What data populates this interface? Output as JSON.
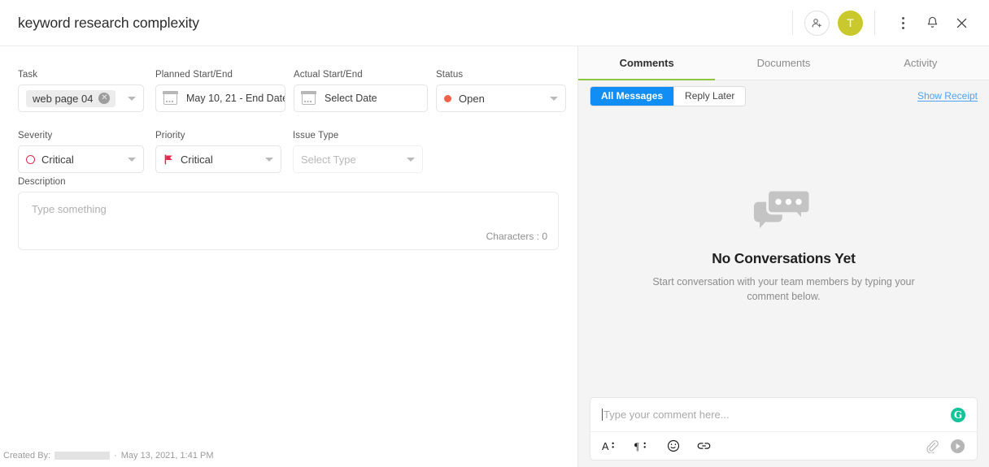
{
  "header": {
    "title": "keyword research complexity",
    "invite_icon": "add-person-icon",
    "avatar_initial": "T",
    "avatar_color": "#c9c92d",
    "more_icon": "vertical-dots-icon",
    "notifications_icon": "bell-icon",
    "close_icon": "close-icon"
  },
  "form": {
    "task": {
      "label": "Task",
      "chip_value": "web page 04",
      "remove_icon": "remove-chip-icon"
    },
    "planned": {
      "label": "Planned Start/End",
      "value": "May 10, 21 - End Date",
      "icon": "calendar-icon"
    },
    "actual": {
      "label": "Actual Start/End",
      "value": "Select Date",
      "icon": "calendar-icon",
      "placeholder": true
    },
    "status": {
      "label": "Status",
      "value": "Open",
      "dot_color": "#f2624a"
    },
    "severity": {
      "label": "Severity",
      "value": "Critical",
      "marker_color": "#e02b4e",
      "marker": "circle-outline-icon"
    },
    "priority": {
      "label": "Priority",
      "value": "Critical",
      "marker_color": "#e02b4e",
      "marker": "flag-icon"
    },
    "issue_type": {
      "label": "Issue Type",
      "value": "Select Type",
      "placeholder": true
    },
    "description": {
      "label": "Description",
      "placeholder": "Type something",
      "value": "",
      "char_count_label": "Characters : 0"
    }
  },
  "footer": {
    "created_by_label": "Created By:",
    "created_by_name": "",
    "separator": "·",
    "created_at": "May 13, 2021, 1:41 PM"
  },
  "right_panel": {
    "tabs": [
      {
        "label": "Comments",
        "active": true
      },
      {
        "label": "Documents",
        "active": false
      },
      {
        "label": "Activity",
        "active": false
      }
    ],
    "active_tab_underline_color": "#8cc63f",
    "filters": [
      {
        "label": "All Messages",
        "active": true
      },
      {
        "label": "Reply Later",
        "active": false
      }
    ],
    "active_filter_color": "#118ef5",
    "show_receipt": "Show Receipt",
    "empty_state": {
      "icon": "chat-bubbles-icon",
      "title": "No Conversations Yet",
      "subtitle": "Start conversation with your team members by typing your comment below."
    },
    "composer": {
      "placeholder": "Type your comment here...",
      "value": "",
      "grammarly_icon": "grammarly-icon",
      "grammarly_letter": "G",
      "grammarly_color": "#15c39a",
      "tools": [
        {
          "icon": "font-format-icon",
          "glyph": "A"
        },
        {
          "icon": "paragraph-format-icon",
          "glyph": "¶"
        },
        {
          "icon": "emoji-icon",
          "glyph": "☺"
        },
        {
          "icon": "link-icon",
          "glyph": "link"
        }
      ],
      "attach_icon": "paperclip-icon",
      "send_icon": "send-icon"
    }
  }
}
